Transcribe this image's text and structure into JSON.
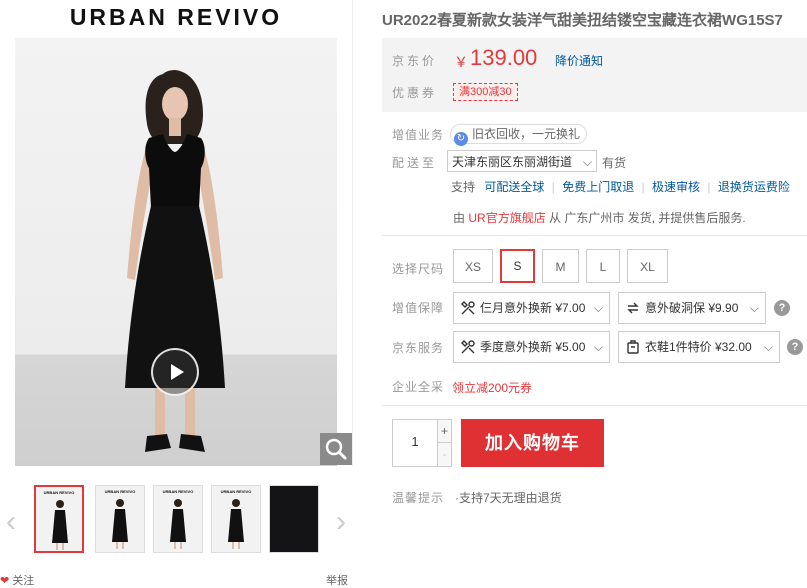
{
  "gallery": {
    "brand": "URBAN REVIVO",
    "thumb_brand": "URBAN REVIVO",
    "thumbs": [
      {
        "label": "URBAN REVIVO",
        "active": true
      },
      {
        "label": "URBAN REVIVO",
        "active": false
      },
      {
        "label": "URBAN REVIVO",
        "active": false
      },
      {
        "label": "URBAN REVIVO",
        "active": false
      },
      {
        "label": "",
        "active": false
      }
    ],
    "follow_label": "关注",
    "report_label": "举报"
  },
  "product": {
    "title": "UR2022春夏新款女装洋气甜美扭结镂空宝藏连衣裙WG15S7"
  },
  "price": {
    "label": "京东价",
    "currency": "￥",
    "value": "139.00",
    "notify": "降价通知"
  },
  "promo": {
    "label": "优惠券",
    "coupon": "满300减30"
  },
  "value_added": {
    "label": "增值业务",
    "pill": "旧衣回收，一元换礼"
  },
  "delivery": {
    "label": "配送至",
    "location": "天津东丽区东丽湖街道",
    "stock": "有货",
    "support_label": "支持",
    "support_items": [
      "可配送全球",
      "免费上门取退",
      "极速审核",
      "退换货运费险"
    ],
    "seller_prefix": "由",
    "seller": "UR官方旗舰店",
    "seller_suffix": "从 广东广州市 发货, 并提供售后服务."
  },
  "sizes": {
    "label": "选择尺码",
    "options": [
      "XS",
      "S",
      "M",
      "L",
      "XL"
    ],
    "selected": "S"
  },
  "guarantee": {
    "label": "增值保障",
    "items": [
      "仨月意外换新 ¥7.00",
      "意外破洞保 ¥9.90"
    ]
  },
  "jd_service": {
    "label": "京东服务",
    "items": [
      "季度意外换新 ¥5.00",
      "衣鞋1件特价 ¥32.00"
    ]
  },
  "enterprise": {
    "label": "企业全采",
    "offer": "领立减200元券"
  },
  "cart": {
    "quantity": "1",
    "plus": "+",
    "minus": "-",
    "button": "加入购物车"
  },
  "tips": {
    "label": "温馨提示",
    "text": "·支持7天无理由退货"
  },
  "colors": {
    "accent": "#e4393c",
    "link": "#005aa0",
    "cart": "#df3033"
  }
}
